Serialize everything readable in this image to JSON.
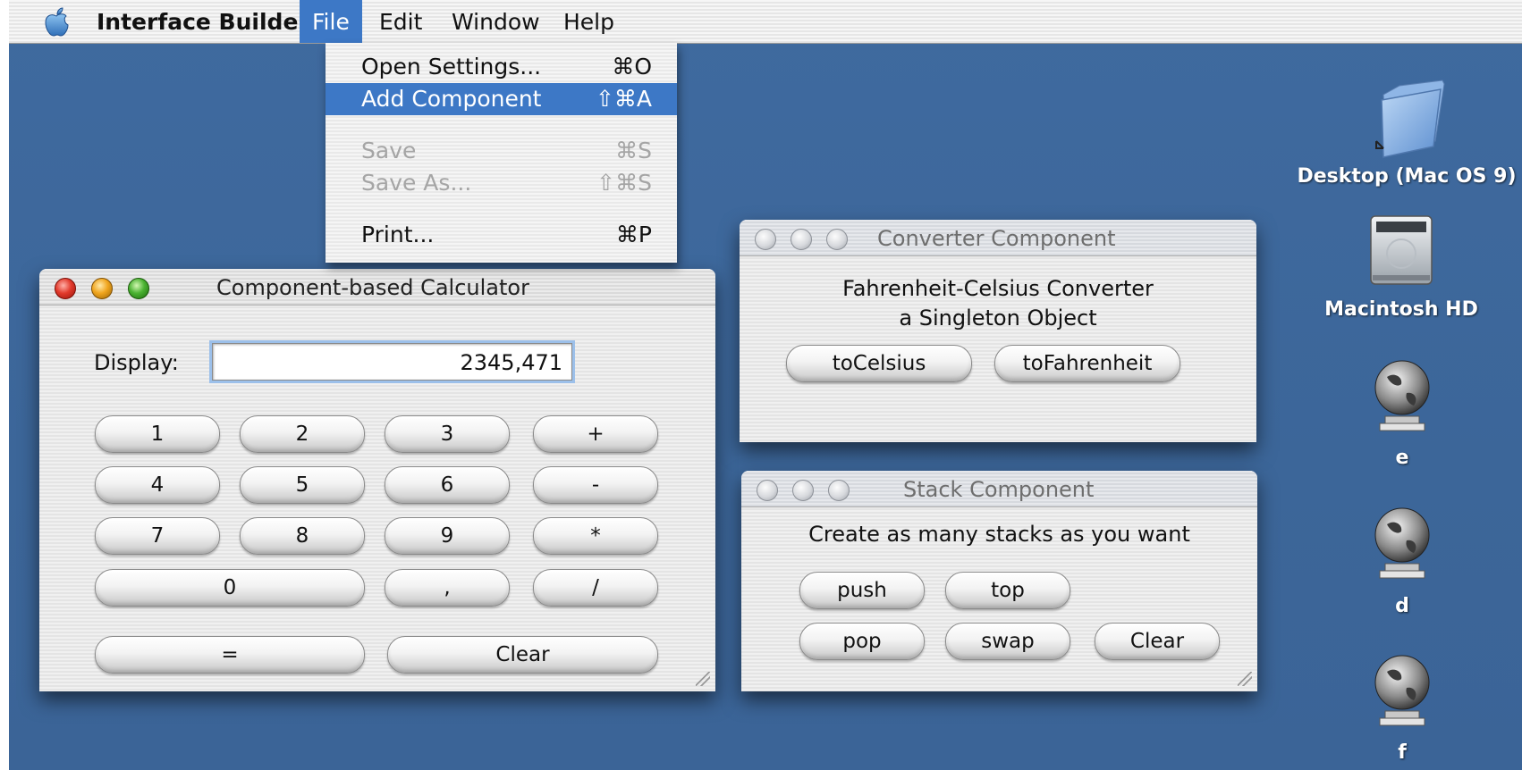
{
  "menubar": {
    "app_name": "Interface Builder",
    "menus": [
      "File",
      "Edit",
      "Window",
      "Help"
    ],
    "active_menu": "File"
  },
  "file_menu": {
    "items": [
      {
        "label": "Open Settings...",
        "shortcut": "⌘O",
        "state": "enabled"
      },
      {
        "label": "Add Component",
        "shortcut": "⇧⌘A",
        "state": "highlighted"
      },
      {
        "label": "Save",
        "shortcut": "⌘S",
        "state": "disabled"
      },
      {
        "label": "Save As...",
        "shortcut": "⇧⌘S",
        "state": "disabled"
      },
      {
        "label": "Print...",
        "shortcut": "⌘P",
        "state": "enabled"
      }
    ]
  },
  "calculator_window": {
    "title": "Component-based Calculator",
    "display_label": "Display:",
    "display_value": "2345,471",
    "keys": [
      "1",
      "2",
      "3",
      "+",
      "4",
      "5",
      "6",
      "-",
      "7",
      "8",
      "9",
      "*",
      "0",
      ",",
      "/",
      "=",
      "Clear"
    ]
  },
  "converter_window": {
    "title": "Converter Component",
    "description_line1": "Fahrenheit-Celsius Converter",
    "description_line2": "a Singleton Object",
    "buttons": [
      "toCelsius",
      "toFahrenheit"
    ]
  },
  "stack_window": {
    "title": "Stack Component",
    "description": "Create as many stacks as you want",
    "buttons": [
      "push",
      "top",
      "pop",
      "swap",
      "Clear"
    ]
  },
  "desktop_icons": [
    {
      "label": "Desktop (Mac OS 9)",
      "icon": "folder-icon"
    },
    {
      "label": "Macintosh HD",
      "icon": "hard-drive-icon"
    },
    {
      "label": "e",
      "icon": "network-volume-icon"
    },
    {
      "label": "d",
      "icon": "network-volume-icon"
    },
    {
      "label": "f",
      "icon": "network-volume-icon"
    }
  ],
  "colors": {
    "desktop": "#3c6699",
    "menu_highlight": "#3d78c6"
  }
}
